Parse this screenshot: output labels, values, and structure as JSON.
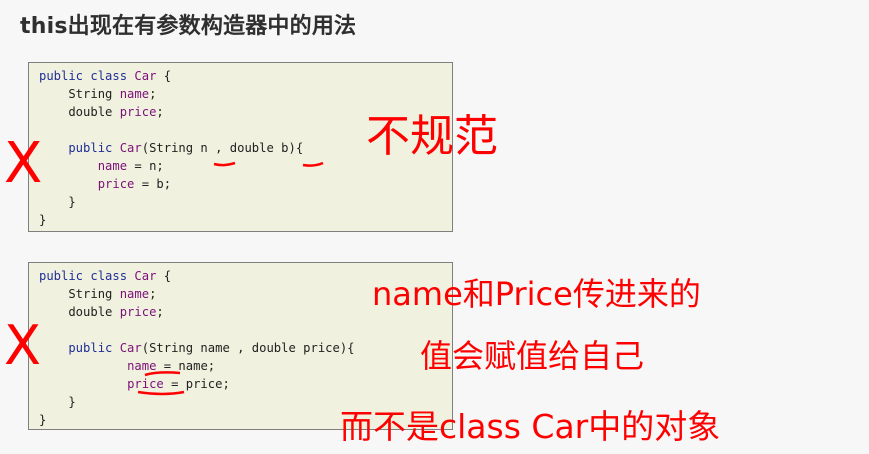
{
  "slide": {
    "title": "this出现在有参数构造器中的用法"
  },
  "code_box_1": {
    "lines": [
      [
        "public class Car {",
        ""
      ],
      [
        "    String ",
        "name;"
      ],
      [
        "    double ",
        "price;"
      ],
      [
        "",
        ""
      ],
      [
        "    public Car(String n , double b){",
        ""
      ],
      [
        "        ",
        "name = n;"
      ],
      [
        "        ",
        "price = b;"
      ],
      [
        "    }",
        ""
      ],
      [
        "}",
        ""
      ]
    ]
  },
  "code_box_2": {
    "lines": [
      [
        "public class Car {",
        ""
      ],
      [
        "    String ",
        "name;"
      ],
      [
        "    double ",
        "price;"
      ],
      [
        "",
        ""
      ],
      [
        "    public Car(String name , double price){",
        ""
      ],
      [
        "            ",
        "name = name;"
      ],
      [
        "            ",
        "price = price;"
      ],
      [
        "    }",
        ""
      ],
      [
        "}",
        ""
      ]
    ]
  },
  "annotations": {
    "mark_1": "X",
    "mark_2": "X",
    "note_1": "不规范",
    "note_2_line_1": "name和Price传进来的",
    "note_2_line_2": "值会赋值给自己",
    "note_2_line_3": "而不是class Car中的对象"
  },
  "colors": {
    "annotation": "#ff0000",
    "code_box_bg": "#f1f1df",
    "keyword": "#1f2f96",
    "identifier": "#7b1178"
  }
}
